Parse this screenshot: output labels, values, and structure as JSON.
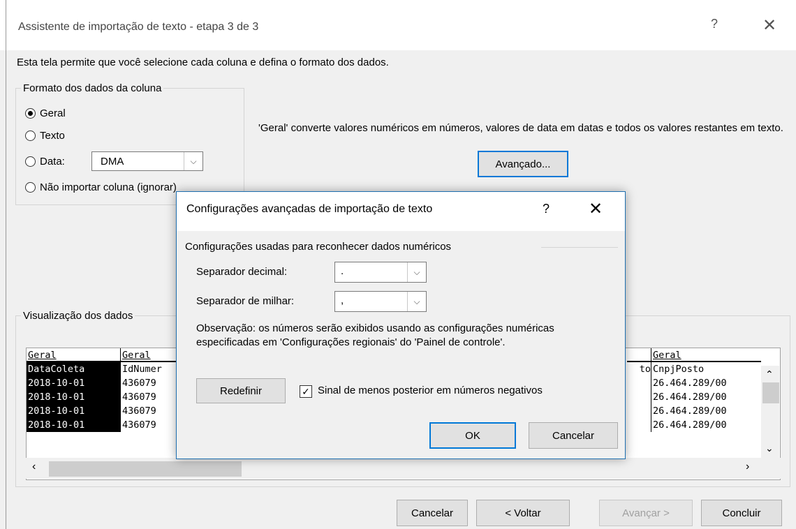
{
  "main": {
    "title": "Assistente de importação de texto - etapa 3 de 3",
    "help": "?",
    "close": "✕",
    "intro": "Esta tela permite que você selecione cada coluna e defina o formato dos dados.",
    "format_group": {
      "legend": "Formato dos dados da coluna",
      "options": {
        "geral": "Geral",
        "texto": "Texto",
        "data": "Data:",
        "nao_importar": "Não importar coluna (ignorar)"
      },
      "selected": "Geral",
      "date_format": "DMA"
    },
    "description": "'Geral' converte valores numéricos em números, valores de data em datas e todos os valores restantes em texto.",
    "advanced_button": "Avançado...",
    "preview": {
      "legend": "Visualização dos dados",
      "columns": [
        {
          "header": "Geral",
          "rows": [
            "DataColeta",
            "2018-10-01",
            "2018-10-01",
            "2018-10-01",
            "2018-10-01"
          ]
        },
        {
          "header": "Geral",
          "rows": [
            "IdNumer",
            "436079",
            "436079",
            "436079",
            "436079"
          ]
        },
        {
          "header": "",
          "rows": [
            "to",
            "",
            "",
            "",
            ""
          ]
        },
        {
          "header": "Geral",
          "rows": [
            "CnpjPosto",
            "26.464.289/00",
            "26.464.289/00",
            "26.464.289/00",
            "26.464.289/00"
          ]
        }
      ]
    },
    "buttons": {
      "cancelar": "Cancelar",
      "voltar": "< Voltar",
      "avancar": "Avançar >",
      "concluir": "Concluir"
    }
  },
  "modal": {
    "title": "Configurações avançadas de importação de texto",
    "help": "?",
    "close": "✕",
    "section": "Configurações usadas para reconhecer dados numéricos",
    "decimal_label": "Separador decimal:",
    "decimal_value": ".",
    "thousands_label": "Separador de milhar:",
    "thousands_value": ",",
    "note": "Observação: os números serão exibidos usando as configurações numéricas especificadas em 'Configurações regionais' do 'Painel de controle'.",
    "reset_button": "Redefinir",
    "checkbox_label": "Sinal de menos posterior em números negativos",
    "checkbox_checked": true,
    "ok_button": "OK",
    "cancel_button": "Cancelar"
  }
}
